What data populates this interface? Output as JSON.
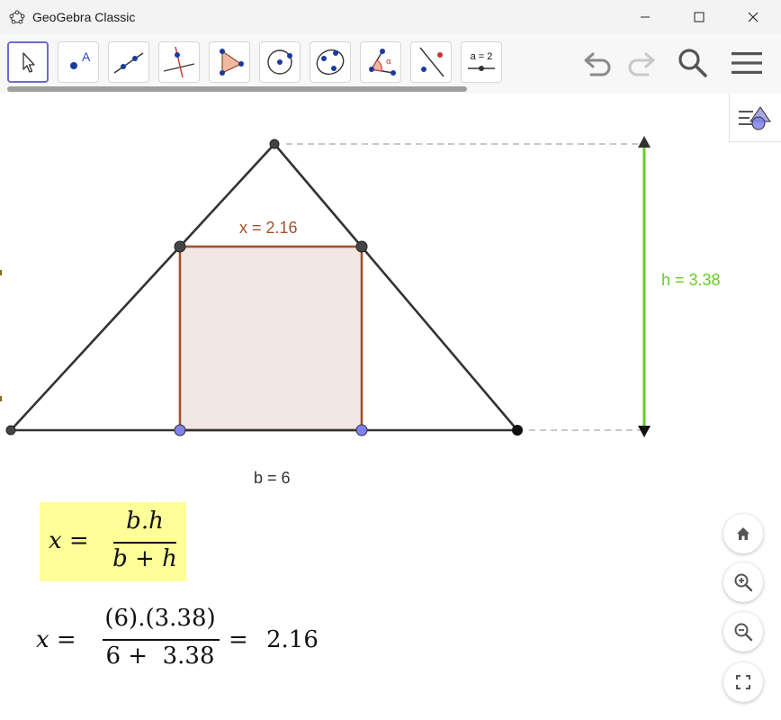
{
  "window": {
    "title": "GeoGebra Classic"
  },
  "toolbar": {
    "tools": [
      {
        "name": "move",
        "icon": "arrow-cursor-icon"
      },
      {
        "name": "point",
        "icon": "point-icon",
        "label": "A"
      },
      {
        "name": "line",
        "icon": "line-icon"
      },
      {
        "name": "perpendicular-line",
        "icon": "perpendicular-icon"
      },
      {
        "name": "polygon",
        "icon": "polygon-icon"
      },
      {
        "name": "circle",
        "icon": "circle-center-icon"
      },
      {
        "name": "circle-three-points",
        "icon": "circle-three-points-icon"
      },
      {
        "name": "angle",
        "icon": "angle-icon",
        "label": "α"
      },
      {
        "name": "reflect",
        "icon": "reflect-icon"
      },
      {
        "name": "slider",
        "icon": "slider-icon",
        "label": "a = 2"
      }
    ],
    "actions": [
      "undo",
      "redo",
      "search",
      "menu"
    ]
  },
  "construction": {
    "x_label": "x = 2.16",
    "h_label": "h = 3.38",
    "b_label": "b = 6",
    "b": 6,
    "h": 3.38,
    "x": 2.16,
    "colors": {
      "triangle": "#333333",
      "square_stroke": "#a0522d",
      "square_fill": "#f2e6e2",
      "height": "#66cc22",
      "dashed": "#c8c8c8",
      "base_points": "#8080ee"
    }
  },
  "formula": {
    "lhs": "x",
    "numerator": "b.h",
    "denominator": "b + h",
    "highlight": "#ffff99"
  },
  "substitution": {
    "lhs": "x",
    "numerator": "(6).(3.38)",
    "denominator": "6 +  3.38",
    "result": "2.16"
  },
  "view_controls": [
    "home",
    "zoom-in",
    "zoom-out",
    "fullscreen"
  ]
}
